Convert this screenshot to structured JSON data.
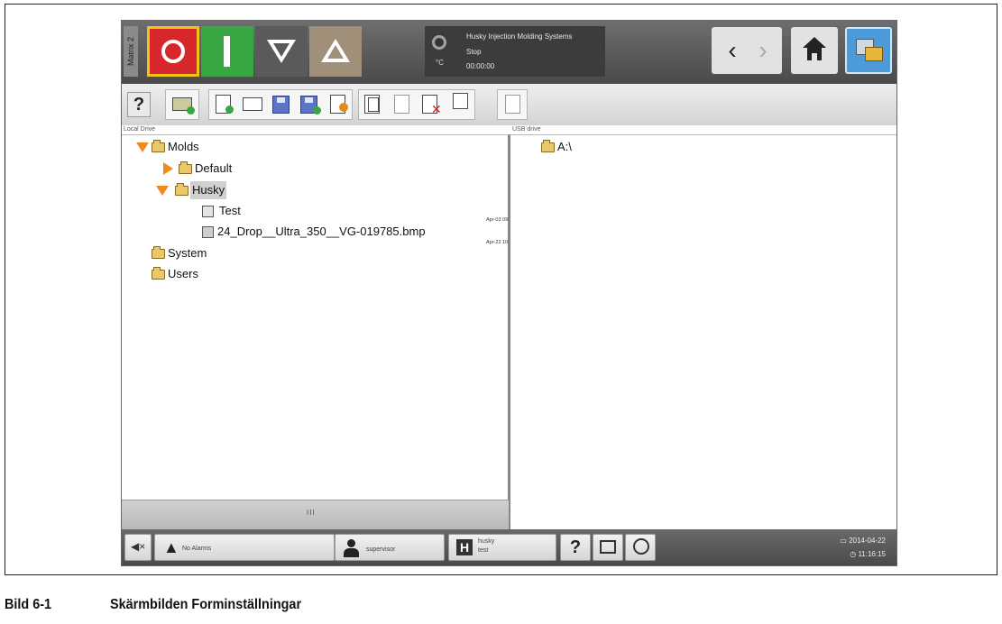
{
  "topbar": {
    "matrix_tab": "Matrix 2",
    "status": {
      "company": "Husky Injection Molding Systems",
      "state": "Stop",
      "time": "00:00:00",
      "unit": "°C"
    },
    "nav_back": "‹",
    "nav_forward": "›"
  },
  "toolbar": {
    "help_label": "?"
  },
  "drives": {
    "left_label": "Local Drive",
    "right_label": "USB drive"
  },
  "tree_left": [
    {
      "label": "Molds"
    },
    {
      "label": "Default"
    },
    {
      "label": "Husky"
    },
    {
      "label": "Test",
      "meta": "Apr-03 09:15"
    },
    {
      "label": "24_Drop__Ultra_350__VG-019785.bmp",
      "meta": "Apr-22 10:02  2.04MB"
    },
    {
      "label": "System"
    },
    {
      "label": "Users"
    }
  ],
  "tree_right": [
    {
      "label": "A:\\"
    }
  ],
  "scroll_grip": "III",
  "bottombar": {
    "alarms": "No Alarms",
    "user": "supervisor",
    "mold_name": "husky",
    "mold_sub": "test",
    "help": "?",
    "date": "2014-04-22",
    "time": "11:16:15"
  },
  "caption": {
    "number": "Bild 6-1",
    "title": "Skärmbilden Forminställningar"
  },
  "colors": {
    "stop": "#d7262c",
    "start": "#3aa543",
    "expander": "#f08a1c",
    "accent_blue": "#4d9ad8"
  }
}
